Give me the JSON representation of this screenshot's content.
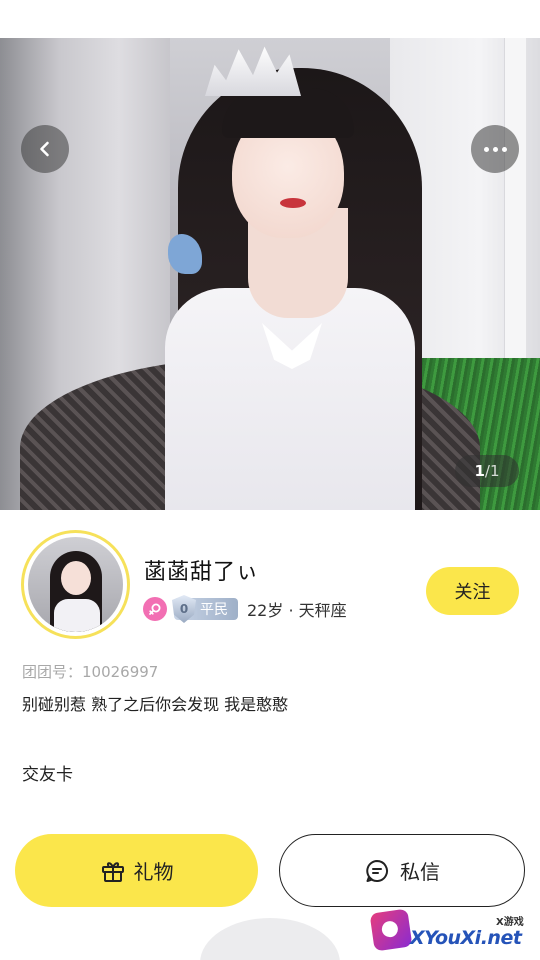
{
  "photo": {
    "counter_current": "1",
    "counter_total": "/1"
  },
  "icons": {
    "back": "chevron-left-icon",
    "more": "more-horizontal-icon",
    "gift": "gift-icon",
    "message": "message-icon",
    "gender": "female-icon"
  },
  "profile": {
    "nickname": "菡菡甜了ぃ",
    "level_number": "0",
    "level_label": "平民",
    "age_sign": "22岁 · 天秤座",
    "follow_label": "关注",
    "tuan_id": "团团号：10026997",
    "bio": "别碰别惹 熟了之后你会发现 我是憨憨",
    "card_title": "交友卡"
  },
  "actions": {
    "gift_label": "礼物",
    "message_label": "私信"
  },
  "watermark": {
    "small": "X游戏",
    "main": "XYouXi.net"
  },
  "colors": {
    "accent_yellow": "#fbe64b",
    "gender_pink": "#f26fb3"
  }
}
